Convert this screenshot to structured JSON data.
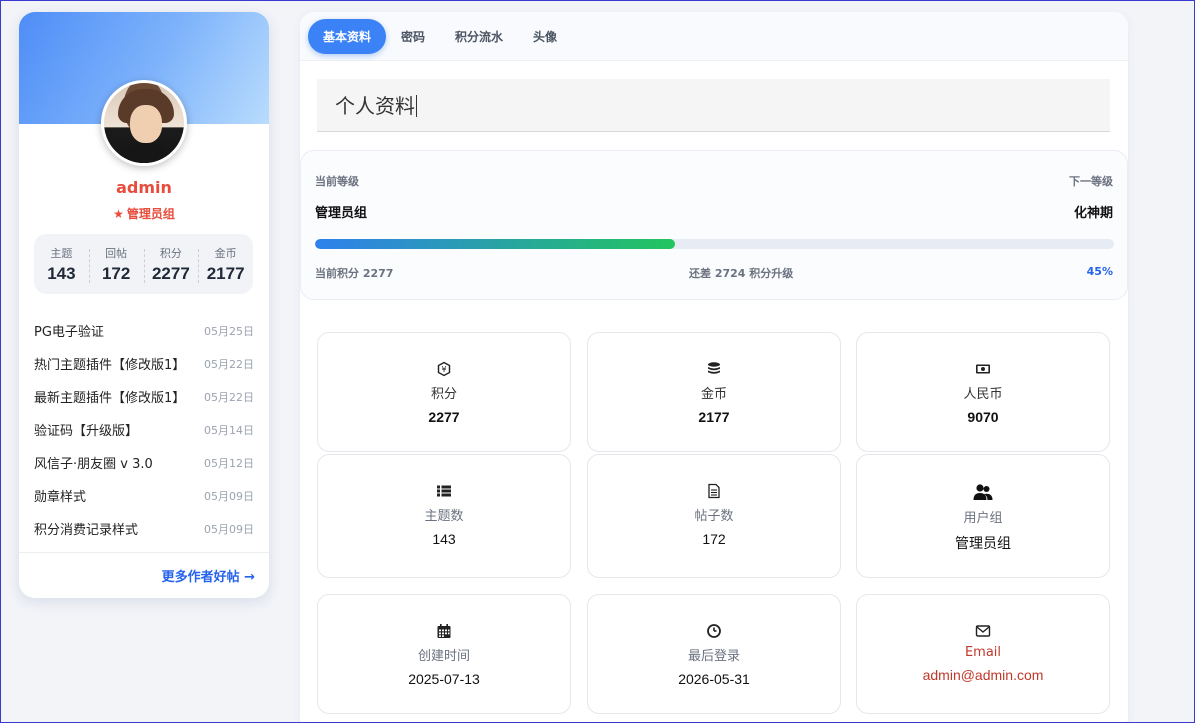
{
  "profile": {
    "name": "admin",
    "group": "管理员组",
    "stats": [
      {
        "label": "主题",
        "value": "143"
      },
      {
        "label": "回帖",
        "value": "172"
      },
      {
        "label": "积分",
        "value": "2277"
      },
      {
        "label": "金币",
        "value": "2177"
      }
    ],
    "posts": [
      {
        "title": "PG电子验证",
        "date": "05月25日"
      },
      {
        "title": "热门主题插件【修改版1】",
        "date": "05月22日"
      },
      {
        "title": "最新主题插件【修改版1】",
        "date": "05月22日"
      },
      {
        "title": "验证码【升级版】",
        "date": "05月14日"
      },
      {
        "title": "风信子·朋友圈 v 3.0",
        "date": "05月12日"
      },
      {
        "title": "勋章样式",
        "date": "05月09日"
      },
      {
        "title": "积分消费记录样式",
        "date": "05月09日"
      }
    ],
    "more_link": "更多作者好帖 →"
  },
  "tabs": [
    "基本资料",
    "密码",
    "积分流水",
    "头像"
  ],
  "active_tab": "基本资料",
  "section_title": "个人资料",
  "level": {
    "current_label": "当前等级",
    "next_label": "下一等级",
    "current": "管理员组",
    "next": "化神期",
    "progress_percent": 45,
    "current_points_text": "当前积分 2277",
    "remaining_text": "还差 2724 积分升级",
    "percent_text": "45%"
  },
  "info_cards": [
    {
      "icon": "points-icon",
      "label": "积分",
      "value": "2277"
    },
    {
      "icon": "coins-icon",
      "label": "金币",
      "value": "2177"
    },
    {
      "icon": "money-icon",
      "label": "人民币",
      "value": "9070"
    },
    {
      "icon": "list-icon",
      "label": "主题数",
      "value": "143"
    },
    {
      "icon": "document-icon",
      "label": "帖子数",
      "value": "172"
    },
    {
      "icon": "users-icon",
      "label": "用户组",
      "value": "管理员组"
    },
    {
      "icon": "calendar-icon",
      "label": "创建时间",
      "value": "2025-07-13"
    },
    {
      "icon": "clock-icon",
      "label": "最后登录",
      "value": "2026-05-31"
    },
    {
      "icon": "envelope-icon",
      "label": "Email",
      "value": "admin@admin.com"
    }
  ],
  "colors": {
    "accent": "#3b82f6",
    "name_red": "#e74c3c",
    "email_red": "#c0392b",
    "link_blue": "#2563eb"
  }
}
